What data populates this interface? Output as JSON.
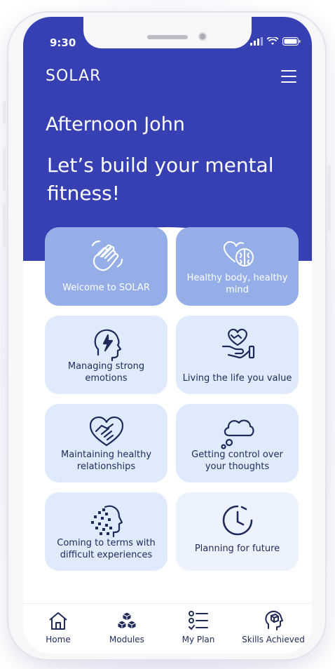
{
  "status_bar": {
    "time": "9:30"
  },
  "app": {
    "brand": "SOLAR"
  },
  "hero": {
    "greeting": "Afternoon John",
    "headline": "Let’s build your mental fitness!"
  },
  "modules": [
    {
      "label": "Welcome to SOLAR",
      "icon": "waving-hand-icon"
    },
    {
      "label": "Healthy body, healthy mind",
      "icon": "heart-brain-icon"
    },
    {
      "label": "Managing strong emotions",
      "icon": "head-lightning-icon"
    },
    {
      "label": "Living the life you value",
      "icon": "heart-in-hand-icon"
    },
    {
      "label": "Maintaining healthy relationships",
      "icon": "heart-handshake-icon"
    },
    {
      "label": "Getting control over your thoughts",
      "icon": "thought-cloud-icon"
    },
    {
      "label": "Coming to terms with difficult experiences",
      "icon": "pixelated-head-icon"
    },
    {
      "label": "Planning for future",
      "icon": "clock-icon"
    }
  ],
  "tab_bar": {
    "home": "Home",
    "modules": "Modules",
    "my_plan": "My Plan",
    "skills": "Skills Achieved"
  },
  "colors": {
    "hero_blue": "#3640b2",
    "card_highlight": "#95aee8",
    "card_light": "#dfeafc",
    "text_dark": "#1e2a5a"
  }
}
